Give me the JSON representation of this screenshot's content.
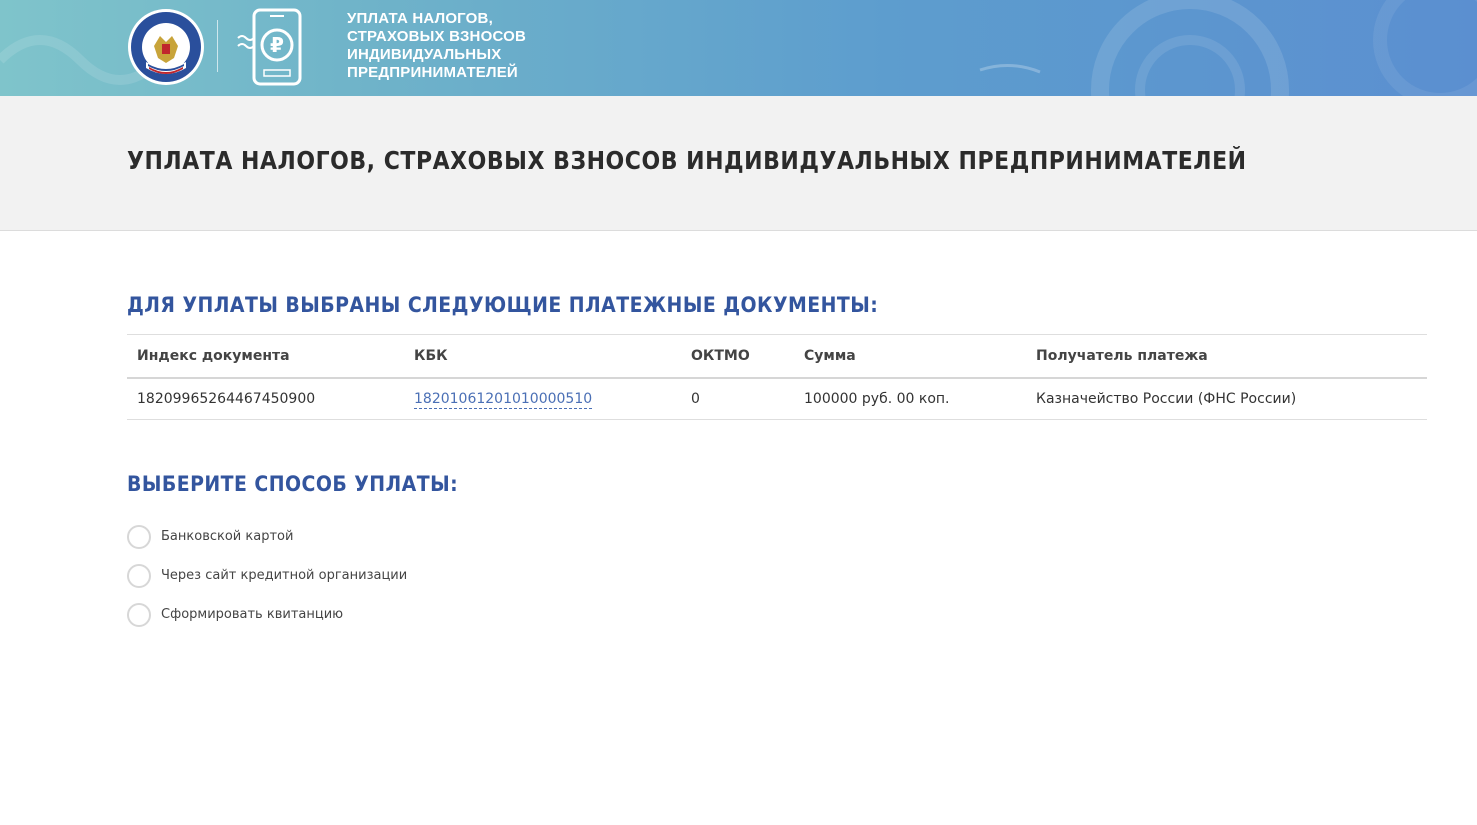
{
  "header": {
    "logo_alt": "Федеральная налоговая служба",
    "title_lines": [
      "Уплата налогов,",
      "страховых взносов",
      "индивидуальных",
      "предпринимателей"
    ]
  },
  "page": {
    "title": "УПЛАТА НАЛОГОВ, СТРАХОВЫХ ВЗНОСОВ ИНДИВИДУАЛЬНЫХ ПРЕДПРИНИМАТЕЛЕЙ"
  },
  "documents": {
    "heading": "ДЛЯ УПЛАТЫ ВЫБРАНЫ СЛЕДУЮЩИЕ ПЛАТЕЖНЫЕ ДОКУМЕНТЫ:",
    "columns": [
      "Индекс документа",
      "КБК",
      "ОКТМО",
      "Сумма",
      "Получатель платежа"
    ],
    "rows": [
      {
        "index": "18209965264467450900",
        "kbk": "18201061201010000510",
        "oktmo": "0",
        "amount": "100000 руб. 00 коп.",
        "recipient": "Казначейство России (ФНС России)"
      }
    ]
  },
  "payment": {
    "heading": "ВЫБЕРИТЕ СПОСОБ УПЛАТЫ:",
    "options": [
      "Банковской картой",
      "Через сайт кредитной организации",
      "Сформировать квитанцию"
    ]
  },
  "colors": {
    "accent": "#33559e",
    "link": "#4a6fb5",
    "banner_start": "#7fc4cb",
    "banner_end": "#5b8fd0"
  }
}
